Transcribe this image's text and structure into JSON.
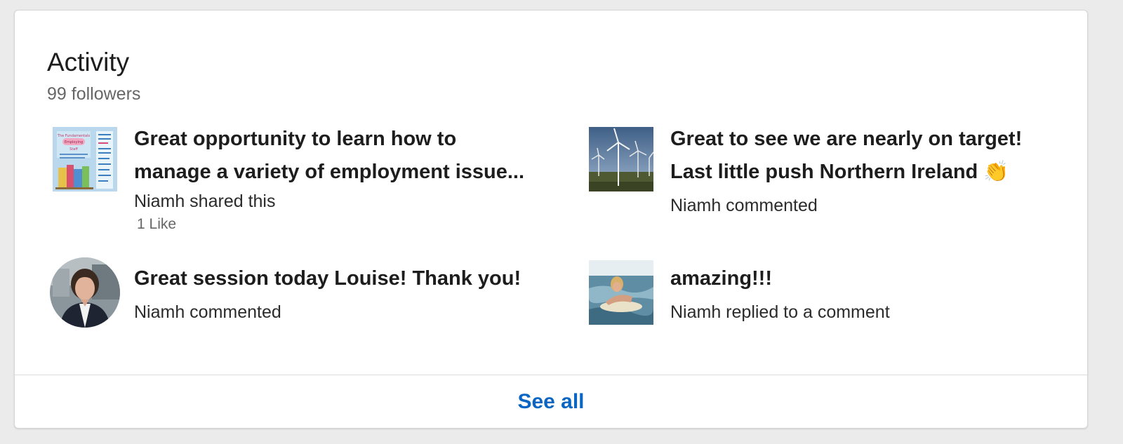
{
  "section": {
    "title": "Activity",
    "followers": "99 followers"
  },
  "items": [
    {
      "headline_line1": "Great opportunity to learn how to",
      "headline_line2": "manage a variety of employment issue...",
      "actor": "Niamh shared this",
      "likes": "1 Like",
      "thumb_icon": "poster-thumbnail"
    },
    {
      "headline_line1": "Great to see we are nearly on target!",
      "headline_line2": "Last little push Northern Ireland",
      "emoji": "👏",
      "actor": "Niamh commented",
      "thumb_icon": "wind-turbines-thumbnail"
    },
    {
      "headline_line1": "Great session today Louise! Thank you!",
      "actor": "Niamh commented",
      "thumb_icon": "profile-photo"
    },
    {
      "headline_line1": "amazing!!!",
      "actor": "Niamh replied to a comment",
      "thumb_icon": "surfer-thumbnail"
    }
  ],
  "footer": {
    "see_all_label": "See all"
  },
  "colors": {
    "link": "#0a66c2",
    "text": "#1d1d1d",
    "muted": "#666666"
  }
}
